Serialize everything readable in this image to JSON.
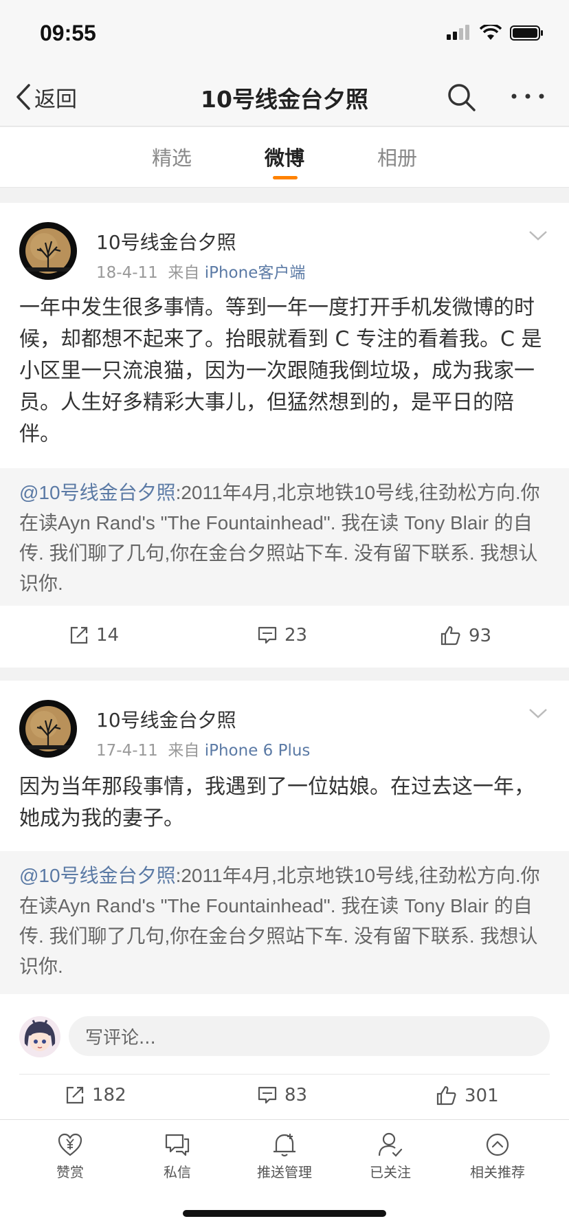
{
  "status_bar": {
    "time": "09:55"
  },
  "nav": {
    "back_label": "返回",
    "title": "10号线金台夕照"
  },
  "tabs": [
    {
      "label": "精选"
    },
    {
      "label": "微博"
    },
    {
      "label": "相册"
    }
  ],
  "active_tab": "微博",
  "posts": [
    {
      "author": "10号线金台夕照",
      "date": "18-4-11",
      "from_prefix": "来自",
      "source": "iPhone客户端",
      "text": "一年中发生很多事情。等到一年一度打开手机发微博的时候，却都想不起来了。抬眼就看到 C 专注的看着我。C 是小区里一只流浪猫，因为一次跟随我倒垃圾，成为我家一员。人生好多精彩大事儿，但猛然想到的，是平日的陪伴。",
      "quote_mention": "@10号线金台夕照",
      "quote_text": ":2011年4月,北京地铁10号线,往劲松方向.你在读Ayn Rand's \"The Fountainhead\". 我在读 Tony Blair 的自传. 我们聊了几句,你在金台夕照站下车. 没有留下联系. 我想认识你.",
      "reposts": "14",
      "comments": "23",
      "likes": "93"
    },
    {
      "author": "10号线金台夕照",
      "date": "17-4-11",
      "from_prefix": "来自",
      "source": "iPhone 6 Plus",
      "text": "因为当年那段事情，我遇到了一位姑娘。在过去这一年，她成为我的妻子。",
      "quote_mention": "@10号线金台夕照",
      "quote_text": ":2011年4月,北京地铁10号线,往劲松方向.你在读Ayn Rand's \"The Fountainhead\". 我在读 Tony Blair 的自传. 我们聊了几句,你在金台夕照站下车. 没有留下联系. 我想认识你.",
      "reposts": "182",
      "comments": "83",
      "likes": "301"
    }
  ],
  "comment_box": {
    "placeholder": "写评论..."
  },
  "bottom_bar": [
    {
      "label": "赞赏",
      "icon": "reward-icon"
    },
    {
      "label": "私信",
      "icon": "message-icon"
    },
    {
      "label": "推送管理",
      "icon": "bell-icon"
    },
    {
      "label": "已关注",
      "icon": "user-check-icon"
    },
    {
      "label": "相关推荐",
      "icon": "chevron-up-circle-icon"
    }
  ],
  "colors": {
    "accent": "#ff8200",
    "link": "#5b7aa5"
  }
}
